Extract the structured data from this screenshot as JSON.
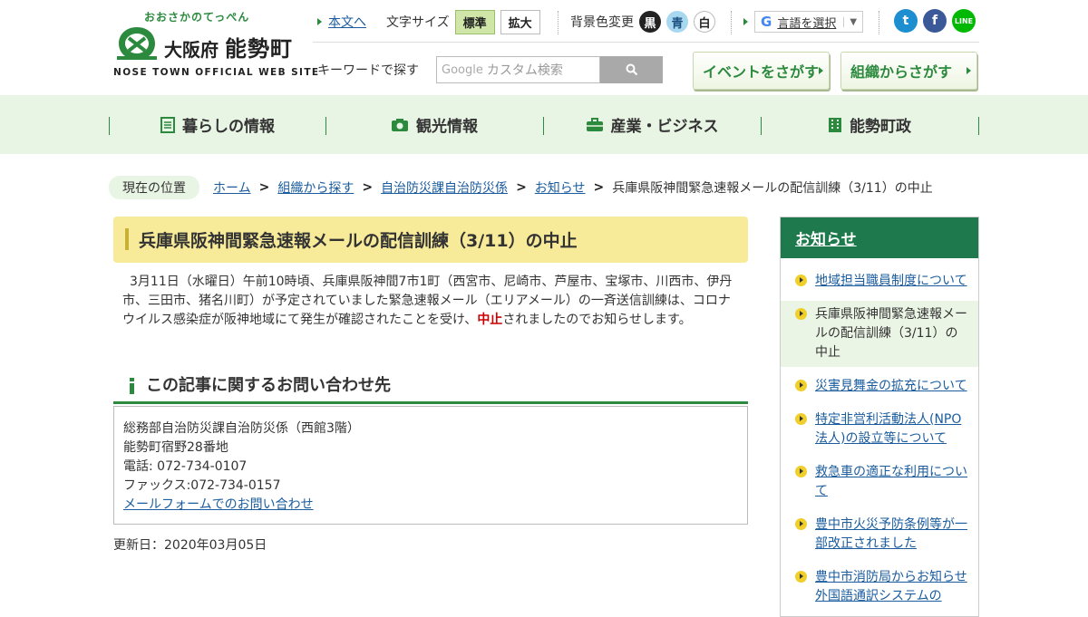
{
  "header": {
    "tagline": "おおさかのてっぺん",
    "pref": "大阪府",
    "town": "能勢町",
    "en_name": "NOSE TOWN OFFICIAL WEB SITE",
    "skip_link": "本文へ",
    "font_size_label": "文字サイズ",
    "font_std": "標準",
    "font_large": "拡大",
    "bg_label": "背景色変更",
    "bg_black": "黒",
    "bg_blue": "青",
    "bg_white": "白",
    "lang_label": "言語を選択",
    "lang_logo": "G",
    "lang_arrow": "▼",
    "search_label": "キーワードで探す",
    "search_placeholder": "カスタム検索",
    "search_brand": "Google",
    "event_btn": "イベントをさがす",
    "org_btn": "組織からさがす",
    "social": [
      "t",
      "f",
      "LINE"
    ],
    "colors": {
      "twitter": "#1da1f2",
      "facebook": "#3b5998",
      "line": "#00b900",
      "brand_green": "#2c8a3e"
    }
  },
  "nav": [
    {
      "label": "暮らしの情報",
      "icon": "document-icon"
    },
    {
      "label": "観光情報",
      "icon": "camera-icon"
    },
    {
      "label": "産業・ビジネス",
      "icon": "briefcase-icon"
    },
    {
      "label": "能勢町政",
      "icon": "building-icon"
    }
  ],
  "breadcrumb": {
    "current_label": "現在の位置",
    "items": [
      "ホーム",
      "組織から探す",
      "自治防災課自治防災係",
      "お知らせ"
    ],
    "current": "兵庫県阪神間緊急速報メールの配信訓練（3/11）の中止",
    "separator": ">"
  },
  "article": {
    "title": "兵庫県阪神間緊急速報メールの配信訓練（3/11）の中止",
    "body_pre": "3月11日（水曜日）午前10時頃、兵庫県阪神間7市1町（西宮市、尼崎市、芦屋市、宝塚市、川西市、伊丹市、三田市、猪名川町）が予定されていました緊急速報メール（エリアメール）の一斉送信訓練は、コロナウイルス感染症が阪神地域にて発生が確認されたことを受け、",
    "body_red": "中止",
    "body_post": "されましたのでお知らせします。",
    "contact_heading": "この記事に関するお問い合わせ先",
    "contact_dept": "総務部自治防災課自治防災係（西館3階）",
    "contact_address": "能勢町宿野28番地",
    "contact_tel": "電話: 072-734-0107",
    "contact_fax": "ファックス:072-734-0157",
    "contact_form": "メールフォームでのお問い合わせ",
    "updated": "更新日：2020年03月05日"
  },
  "sidebar": {
    "heading": "お知らせ",
    "items": [
      "地域担当職員制度について",
      "兵庫県阪神間緊急速報メールの配信訓練（3/11）の中止",
      "災害見舞金の拡充について",
      "特定非営利活動法人(NPO法人)の設立等について",
      "救急車の適正な利用について",
      "豊中市火災予防条例等が一部改正されました",
      "豊中市消防局からお知らせ 外国語通訳システムの"
    ],
    "current_index": 1
  }
}
